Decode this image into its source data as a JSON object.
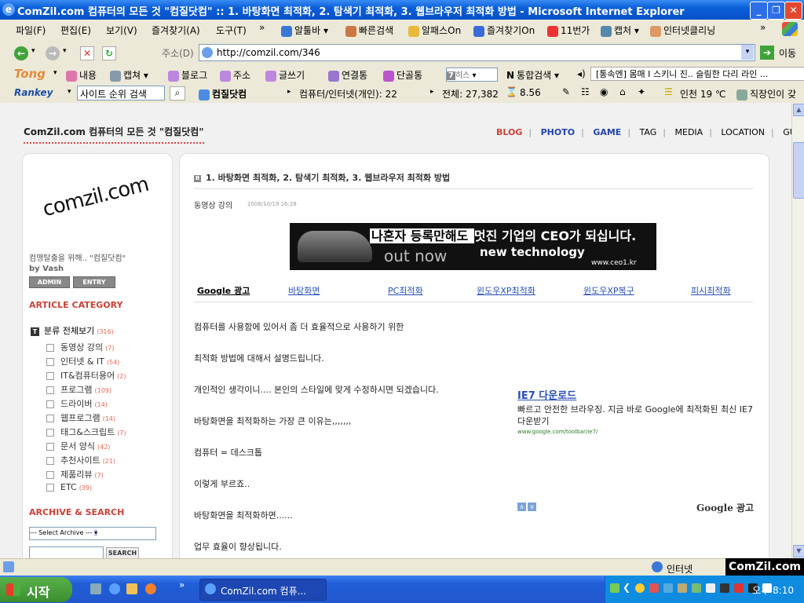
{
  "window": {
    "title": "ComZil.com 컴퓨터의 모든 것 \"컴질닷컴\" :: 1. 바탕화면 최적화, 2. 탐색기 최적화, 3. 웹브라우저 최적화 방법 - Microsoft Internet Explorer"
  },
  "menubar": {
    "items": [
      "파일(F)",
      "편집(E)",
      "보기(V)",
      "즐겨찾기(A)",
      "도구(T)",
      "»"
    ],
    "links": [
      "알툴바",
      "빠른검색",
      "알패스On",
      "즐겨찾기On",
      "11번가",
      "캡처",
      "인터넷클리닝",
      "»"
    ]
  },
  "navbar": {
    "address_label": "주소(D)",
    "url": "http://comzil.com/346",
    "go_label": "이동"
  },
  "tongbar": {
    "logo": "Tong",
    "items": [
      "내용",
      "캡쳐",
      "블로그",
      "주소",
      "글쓰기",
      "연결통",
      "단골통"
    ],
    "select": "히스",
    "search_label": "통합검색",
    "ticker": "[통속엔] 몸매 I 스키니 진.. 슬림한 다리 라인 ..."
  },
  "rankbar": {
    "logo": "Rankey",
    "search_value": "사이트 순위 검색",
    "site": "컴질닷컴",
    "category": "컴퓨터/인터넷(개인): 22",
    "total": "전체: 27,382",
    "time": "8.56",
    "weather": "인천 19 ℃",
    "job": "직장인이 갖"
  },
  "blog": {
    "title": "ComZil.com 컴퓨터의 모든 것 \"컴질닷컴\"",
    "nav": [
      "BLOG",
      "PHOTO",
      "GAME",
      "TAG",
      "MEDIA",
      "LOCATION",
      "GUESTBOOK"
    ],
    "logo_text": "comzil.com",
    "tagline": "컴맹탈출을 위해.. \"컴질닷컴\"",
    "by": "by Vash",
    "admin_btn": "ADMIN",
    "entry_btn": "ENTRY",
    "article_category_title": "ARTICLE CATEGORY",
    "all_label": "분류 전체보기",
    "all_count": "(316)",
    "categories": [
      {
        "name": "동영상 강의",
        "count": "(7)"
      },
      {
        "name": "인터넷 & IT",
        "count": "(54)"
      },
      {
        "name": "IT&컴퓨터용어",
        "count": "(2)"
      },
      {
        "name": "프로그램",
        "count": "(109)"
      },
      {
        "name": "드라이버",
        "count": "(14)"
      },
      {
        "name": "웹프로그램",
        "count": "(14)"
      },
      {
        "name": "태그&스크립트",
        "count": "(7)"
      },
      {
        "name": "문서 양식",
        "count": "(42)"
      },
      {
        "name": "추천사이트",
        "count": "(21)"
      },
      {
        "name": "제품리뷰",
        "count": "(7)"
      },
      {
        "name": "ETC",
        "count": "(39)"
      }
    ],
    "archive_title": "ARCHIVE & SEARCH",
    "archive_select": "--- Select Archive ---",
    "search_btn": "SEARCH"
  },
  "post": {
    "title": "1. 바탕화면 최적화, 2. 탐색기 최적화, 3. 웹브라우저 최적화 방법",
    "category": "동영상 강의",
    "date": "2008/10/19 16:28",
    "ad": {
      "l1a": "나혼자 등록만해도 ",
      "l1b": "멋진 기업의 CEO가 되십니다.",
      "l2": "out now",
      "l3": "new technology",
      "l4": "www.ceo1.kr"
    },
    "google_label": "Google 광고",
    "google_links": [
      "바탕화면",
      "PC최적화",
      "윈도우XP최적화",
      "윈도우XP복구",
      "피시최적화"
    ],
    "paragraphs": [
      "컴퓨터를 사용함에 있어서 좀 더 효율적으로 사용하기 위한",
      "최적화 방법에 대해서 설명드립니다.",
      "개인적인 생각이니.... 본인의 스타일에 맞게 수정하시면 되겠습니다.",
      "바탕화면을 최적화하는 가장 큰 이유는,,,,,,,",
      "컴퓨터 = 데스크톱",
      "이렇게 부르죠..",
      "바탕화면을 최적화하면......",
      "업무 효율이 향상됩니다."
    ],
    "side_ad": {
      "headline": "IE7 다운로드",
      "desc": "빠르고 안전한 브라우징. 지금 바로 Google에 최적화된 최신 IE7 다운받기",
      "url": "www.google.com/toolbar/ie7/"
    },
    "google_ad_label": "Google 광고"
  },
  "statusbar": {
    "zone": "인터넷",
    "watermark": "ComZil.com"
  },
  "taskbar": {
    "start": "시작",
    "window": "ComZil.com 컴퓨...",
    "clock": "오후 8:10"
  }
}
